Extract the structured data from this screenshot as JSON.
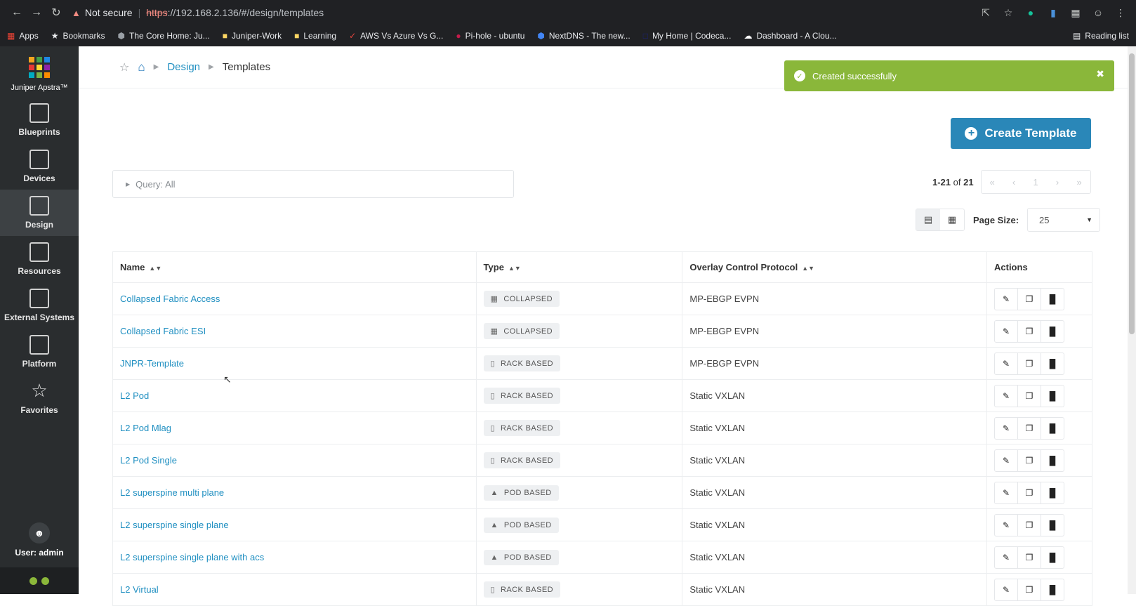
{
  "browser": {
    "security_label": "Not secure",
    "url_scheme": "https",
    "url_rest": "://192.168.2.136/#/design/templates",
    "bookmarks": [
      {
        "label": "Apps",
        "icon": "apps-grid-icon"
      },
      {
        "label": "Bookmarks",
        "icon": "star-icon"
      },
      {
        "label": "The Core Home: Ju...",
        "icon": "shield-icon"
      },
      {
        "label": "Juniper-Work",
        "icon": "folder-icon"
      },
      {
        "label": "Learning",
        "icon": "folder-icon"
      },
      {
        "label": "AWS Vs Azure Vs G...",
        "icon": "site-icon"
      },
      {
        "label": "Pi-hole - ubuntu",
        "icon": "raspberry-icon"
      },
      {
        "label": "NextDNS - The new...",
        "icon": "shield-icon"
      },
      {
        "label": "My Home | Codeca...",
        "icon": "page-icon"
      },
      {
        "label": "Dashboard - A Clou...",
        "icon": "cloud-icon"
      }
    ],
    "reading_list": "Reading list"
  },
  "sidebar": {
    "brand": "Juniper Apstra™",
    "items": [
      {
        "label": "Blueprints",
        "icon": "blueprints-icon",
        "active": false
      },
      {
        "label": "Devices",
        "icon": "devices-icon",
        "active": false
      },
      {
        "label": "Design",
        "icon": "design-icon",
        "active": true
      },
      {
        "label": "Resources",
        "icon": "resources-icon",
        "active": false
      },
      {
        "label": "External Systems",
        "icon": "external-systems-icon",
        "active": false
      },
      {
        "label": "Platform",
        "icon": "platform-icon",
        "active": false
      },
      {
        "label": "Favorites",
        "icon": "star-icon",
        "active": false
      }
    ],
    "user": "User: admin"
  },
  "breadcrumb": {
    "design": "Design",
    "current": "Templates"
  },
  "toast": {
    "message": "Created successfully"
  },
  "actions": {
    "create": "Create Template"
  },
  "query": {
    "label": "Query: All"
  },
  "paging": {
    "range": "1-21",
    "of": "of",
    "total": "21",
    "page": "1",
    "page_size_label": "Page Size:",
    "page_size": "25"
  },
  "table": {
    "headers": {
      "name": "Name",
      "type": "Type",
      "overlay": "Overlay Control Protocol",
      "actions": "Actions"
    },
    "rows": [
      {
        "name": "Collapsed Fabric Access",
        "type": "COLLAPSED",
        "overlay": "MP-EBGP EVPN"
      },
      {
        "name": "Collapsed Fabric ESI",
        "type": "COLLAPSED",
        "overlay": "MP-EBGP EVPN"
      },
      {
        "name": "JNPR-Template",
        "type": "RACK BASED",
        "overlay": "MP-EBGP EVPN"
      },
      {
        "name": "L2 Pod",
        "type": "RACK BASED",
        "overlay": "Static VXLAN"
      },
      {
        "name": "L2 Pod Mlag",
        "type": "RACK BASED",
        "overlay": "Static VXLAN"
      },
      {
        "name": "L2 Pod Single",
        "type": "RACK BASED",
        "overlay": "Static VXLAN"
      },
      {
        "name": "L2 superspine multi plane",
        "type": "POD BASED",
        "overlay": "Static VXLAN"
      },
      {
        "name": "L2 superspine single plane",
        "type": "POD BASED",
        "overlay": "Static VXLAN"
      },
      {
        "name": "L2 superspine single plane with acs",
        "type": "POD BASED",
        "overlay": "Static VXLAN"
      },
      {
        "name": "L2 Virtual",
        "type": "RACK BASED",
        "overlay": "Static VXLAN"
      }
    ]
  },
  "colors": {
    "accent": "#2a87b8",
    "link": "#1f8fc1",
    "success": "#8ab73a",
    "sidebar": "#2a2d2f"
  }
}
